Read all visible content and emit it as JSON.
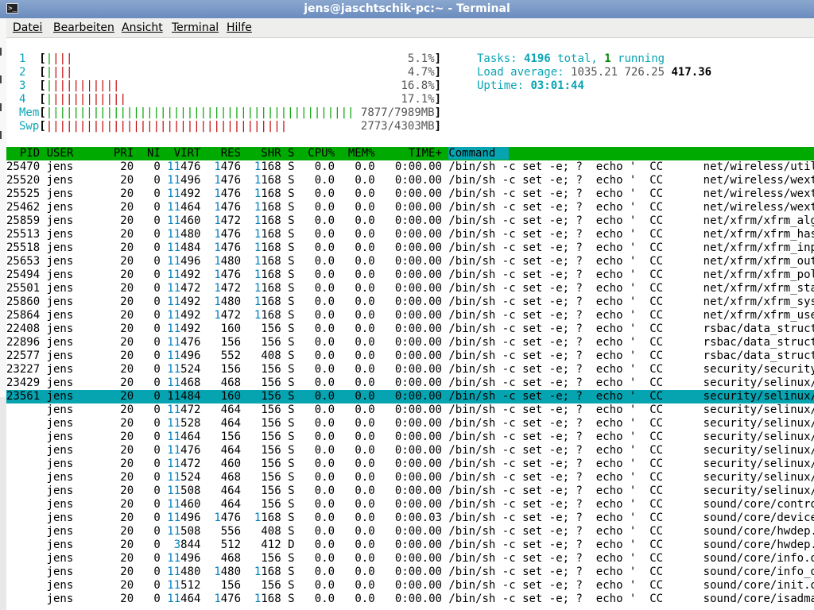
{
  "window": {
    "title": "jens@jaschtschik-pc:~ - Terminal"
  },
  "menu": [
    {
      "label": "Datei"
    },
    {
      "label": "Bearbeiten"
    },
    {
      "label": "Ansicht"
    },
    {
      "label": "Terminal"
    },
    {
      "label": "Hilfe"
    }
  ],
  "meters": {
    "cpus": [
      {
        "id": "1",
        "green": 1,
        "red": 3,
        "pct": "5.1%"
      },
      {
        "id": "2",
        "green": 1,
        "red": 3,
        "pct": "4.7%"
      },
      {
        "id": "3",
        "green": 1,
        "red": 10,
        "pct": "16.8%"
      },
      {
        "id": "4",
        "green": 1,
        "red": 11,
        "pct": "17.1%"
      }
    ],
    "mem": {
      "label": "Mem",
      "value": "7877/7989MB"
    },
    "swp": {
      "label": "Swp",
      "value": "2773/4303MB"
    },
    "tasks_label": "Tasks:",
    "tasks_total": "4196",
    "tasks_total_word": "total,",
    "tasks_running": "1",
    "tasks_running_word": "running",
    "load_label": "Load average:",
    "load1": "1035.21",
    "load5": "726.25",
    "load15": "417.36",
    "uptime_label": "Uptime:",
    "uptime": "03:01:44"
  },
  "columns": [
    "PID",
    "USER",
    "PRI",
    "NI",
    "VIRT",
    "RES",
    "SHR",
    "S",
    "CPU%",
    "MEM%",
    "TIME+",
    "Command"
  ],
  "selected_pid": "23561",
  "processes": [
    {
      "pid": "25470",
      "user": "jens",
      "pri": "20",
      "ni": "0",
      "virt": "11476",
      "res": "1476",
      "shr": "1168",
      "s": "S",
      "cpu": "0.0",
      "mem": "0.0",
      "time": "0:00.00",
      "cmd": "/bin/sh -c set -e; ?  echo '  CC      net/wireless/util.o'; gcc"
    },
    {
      "pid": "25520",
      "user": "jens",
      "pri": "20",
      "ni": "0",
      "virt": "11496",
      "res": "1476",
      "shr": "1168",
      "s": "S",
      "cpu": "0.0",
      "mem": "0.0",
      "time": "0:00.00",
      "cmd": "/bin/sh -c set -e; ?  echo '  CC      net/wireless/wext-compat.o"
    },
    {
      "pid": "25525",
      "user": "jens",
      "pri": "20",
      "ni": "0",
      "virt": "11492",
      "res": "1476",
      "shr": "1168",
      "s": "S",
      "cpu": "0.0",
      "mem": "0.0",
      "time": "0:00.00",
      "cmd": "/bin/sh -c set -e; ?  echo '  CC      net/wireless/wext-sme.o';"
    },
    {
      "pid": "25462",
      "user": "jens",
      "pri": "20",
      "ni": "0",
      "virt": "11464",
      "res": "1476",
      "shr": "1168",
      "s": "S",
      "cpu": "0.0",
      "mem": "0.0",
      "time": "0:00.00",
      "cmd": "/bin/sh -c set -e; ?  echo '  CC      net/wireless/wext.o'; gcc"
    },
    {
      "pid": "25859",
      "user": "jens",
      "pri": "20",
      "ni": "0",
      "virt": "11460",
      "res": "1472",
      "shr": "1168",
      "s": "S",
      "cpu": "0.0",
      "mem": "0.0",
      "time": "0:00.00",
      "cmd": "/bin/sh -c set -e; ?  echo '  CC      net/xfrm/xfrm_algo.o'; gcc"
    },
    {
      "pid": "25513",
      "user": "jens",
      "pri": "20",
      "ni": "0",
      "virt": "11480",
      "res": "1476",
      "shr": "1168",
      "s": "S",
      "cpu": "0.0",
      "mem": "0.0",
      "time": "0:00.00",
      "cmd": "/bin/sh -c set -e; ?  echo '  CC      net/xfrm/xfrm_hash.o'; gcc"
    },
    {
      "pid": "25518",
      "user": "jens",
      "pri": "20",
      "ni": "0",
      "virt": "11484",
      "res": "1476",
      "shr": "1168",
      "s": "S",
      "cpu": "0.0",
      "mem": "0.0",
      "time": "0:00.00",
      "cmd": "/bin/sh -c set -e; ?  echo '  CC      net/xfrm/xfrm_input.o'; gcc"
    },
    {
      "pid": "25653",
      "user": "jens",
      "pri": "20",
      "ni": "0",
      "virt": "11496",
      "res": "1480",
      "shr": "1168",
      "s": "S",
      "cpu": "0.0",
      "mem": "0.0",
      "time": "0:00.00",
      "cmd": "/bin/sh -c set -e; ?  echo '  CC      net/xfrm/xfrm_output.o'; g"
    },
    {
      "pid": "25494",
      "user": "jens",
      "pri": "20",
      "ni": "0",
      "virt": "11492",
      "res": "1476",
      "shr": "1168",
      "s": "S",
      "cpu": "0.0",
      "mem": "0.0",
      "time": "0:00.00",
      "cmd": "/bin/sh -c set -e; ?  echo '  CC      net/xfrm/xfrm_policy.o'; g"
    },
    {
      "pid": "25501",
      "user": "jens",
      "pri": "20",
      "ni": "0",
      "virt": "11472",
      "res": "1472",
      "shr": "1168",
      "s": "S",
      "cpu": "0.0",
      "mem": "0.0",
      "time": "0:00.00",
      "cmd": "/bin/sh -c set -e; ?  echo '  CC      net/xfrm/xfrm_state.o'; gcc"
    },
    {
      "pid": "25860",
      "user": "jens",
      "pri": "20",
      "ni": "0",
      "virt": "11492",
      "res": "1480",
      "shr": "1168",
      "s": "S",
      "cpu": "0.0",
      "mem": "0.0",
      "time": "0:00.00",
      "cmd": "/bin/sh -c set -e; ?  echo '  CC      net/xfrm/xfrm_sysctl.o'; g"
    },
    {
      "pid": "25864",
      "user": "jens",
      "pri": "20",
      "ni": "0",
      "virt": "11492",
      "res": "1472",
      "shr": "1168",
      "s": "S",
      "cpu": "0.0",
      "mem": "0.0",
      "time": "0:00.00",
      "cmd": "/bin/sh -c set -e; ?  echo '  CC      net/xfrm/xfrm_user.o'; gcc"
    },
    {
      "pid": "22408",
      "user": "jens",
      "pri": "20",
      "ni": "0",
      "virt": "11492",
      "res": "160",
      "shr": "156",
      "s": "S",
      "cpu": "0.0",
      "mem": "0.0",
      "time": "0:00.00",
      "cmd": "/bin/sh -c set -e; ?  echo '  CC      rsbac/data_structures/aci_"
    },
    {
      "pid": "22896",
      "user": "jens",
      "pri": "20",
      "ni": "0",
      "virt": "11476",
      "res": "156",
      "shr": "156",
      "s": "S",
      "cpu": "0.0",
      "mem": "0.0",
      "time": "0:00.00",
      "cmd": "/bin/sh -c set -e; ?  echo '  CC      rsbac/data_structures/acl_"
    },
    {
      "pid": "22577",
      "user": "jens",
      "pri": "20",
      "ni": "0",
      "virt": "11496",
      "res": "552",
      "shr": "408",
      "s": "S",
      "cpu": "0.0",
      "mem": "0.0",
      "time": "0:00.00",
      "cmd": "/bin/sh -c set -e; ?  echo '  CC      rsbac/data_structures/gen_"
    },
    {
      "pid": "23227",
      "user": "jens",
      "pri": "20",
      "ni": "0",
      "virt": "11524",
      "res": "156",
      "shr": "156",
      "s": "S",
      "cpu": "0.0",
      "mem": "0.0",
      "time": "0:00.00",
      "cmd": "/bin/sh -c set -e; ?  echo '  CC      security/security.o'; gcc"
    },
    {
      "pid": "23429",
      "user": "jens",
      "pri": "20",
      "ni": "0",
      "virt": "11468",
      "res": "468",
      "shr": "156",
      "s": "S",
      "cpu": "0.0",
      "mem": "0.0",
      "time": "0:00.00",
      "cmd": "/bin/sh -c set -e; ?  echo '  CC      security/selinux/hooks.o';"
    },
    {
      "pid": "23561",
      "user": "jens",
      "pri": "20",
      "ni": "0",
      "virt": "11484",
      "res": "160",
      "shr": "156",
      "s": "S",
      "cpu": "0.0",
      "mem": "0.0",
      "time": "0:00.00",
      "cmd": "/bin/sh -c set -e; ?  echo '  CC      security/selinux/selinuxfs"
    },
    {
      "pid": "",
      "user": "jens",
      "pri": "20",
      "ni": "0",
      "virt": "11472",
      "res": "464",
      "shr": "156",
      "s": "S",
      "cpu": "0.0",
      "mem": "0.0",
      "time": "0:00.00",
      "cmd": "/bin/sh -c set -e; ?  echo '  CC      security/selinux/ss/avtab."
    },
    {
      "pid": "",
      "user": "jens",
      "pri": "20",
      "ni": "0",
      "virt": "11528",
      "res": "464",
      "shr": "156",
      "s": "S",
      "cpu": "0.0",
      "mem": "0.0",
      "time": "0:00.00",
      "cmd": "/bin/sh -c set -e; ?  echo '  CC      security/selinux/ss/condit"
    },
    {
      "pid": "",
      "user": "jens",
      "pri": "20",
      "ni": "0",
      "virt": "11464",
      "res": "156",
      "shr": "156",
      "s": "S",
      "cpu": "0.0",
      "mem": "0.0",
      "time": "0:00.00",
      "cmd": "/bin/sh -c set -e; ?  echo '  CC      security/selinux/ss/ebitma"
    },
    {
      "pid": "",
      "user": "jens",
      "pri": "20",
      "ni": "0",
      "virt": "11476",
      "res": "464",
      "shr": "156",
      "s": "S",
      "cpu": "0.0",
      "mem": "0.0",
      "time": "0:00.00",
      "cmd": "/bin/sh -c set -e; ?  echo '  CC      security/selinux/ss/mls.o'"
    },
    {
      "pid": "",
      "user": "jens",
      "pri": "20",
      "ni": "0",
      "virt": "11472",
      "res": "460",
      "shr": "156",
      "s": "S",
      "cpu": "0.0",
      "mem": "0.0",
      "time": "0:00.00",
      "cmd": "/bin/sh -c set -e; ?  echo '  CC      security/selinux/ss/policy"
    },
    {
      "pid": "",
      "user": "jens",
      "pri": "20",
      "ni": "0",
      "virt": "11524",
      "res": "468",
      "shr": "156",
      "s": "S",
      "cpu": "0.0",
      "mem": "0.0",
      "time": "0:00.00",
      "cmd": "/bin/sh -c set -e; ?  echo '  CC      security/selinux/ss/servic"
    },
    {
      "pid": "",
      "user": "jens",
      "pri": "20",
      "ni": "0",
      "virt": "11508",
      "res": "464",
      "shr": "156",
      "s": "S",
      "cpu": "0.0",
      "mem": "0.0",
      "time": "0:00.00",
      "cmd": "/bin/sh -c set -e; ?  echo '  CC      security/selinux/ss/sidtab"
    },
    {
      "pid": "",
      "user": "jens",
      "pri": "20",
      "ni": "0",
      "virt": "11460",
      "res": "464",
      "shr": "156",
      "s": "S",
      "cpu": "0.0",
      "mem": "0.0",
      "time": "0:00.00",
      "cmd": "/bin/sh -c set -e; ?  echo '  CC      sound/core/control.o'; gcc"
    },
    {
      "pid": "",
      "user": "jens",
      "pri": "20",
      "ni": "0",
      "virt": "11496",
      "res": "1476",
      "shr": "1168",
      "s": "S",
      "cpu": "0.0",
      "mem": "0.0",
      "time": "0:00.03",
      "cmd": "/bin/sh -c set -e; ?  echo '  CC      sound/core/device.o'; gcc"
    },
    {
      "pid": "",
      "user": "jens",
      "pri": "20",
      "ni": "0",
      "virt": "11508",
      "res": "556",
      "shr": "408",
      "s": "S",
      "cpu": "0.0",
      "mem": "0.0",
      "time": "0:00.00",
      "cmd": "/bin/sh -c set -e; ?  echo '  CC      sound/core/hwdep.o'; gcc -"
    },
    {
      "pid": "",
      "user": "jens",
      "pri": "20",
      "ni": "0",
      "virt": "3844",
      "res": "512",
      "shr": "412",
      "s": "D",
      "cpu": "0.0",
      "mem": "0.0",
      "time": "0:00.00",
      "cmd": "/bin/sh -c set -e; ?  echo '  CC      sound/core/hwdep.o'; gcc -"
    },
    {
      "pid": "",
      "user": "jens",
      "pri": "20",
      "ni": "0",
      "virt": "11496",
      "res": "468",
      "shr": "156",
      "s": "S",
      "cpu": "0.0",
      "mem": "0.0",
      "time": "0:00.00",
      "cmd": "/bin/sh -c set -e; ?  echo '  CC      sound/core/info.o'; gcc -W"
    },
    {
      "pid": "",
      "user": "jens",
      "pri": "20",
      "ni": "0",
      "virt": "11480",
      "res": "1480",
      "shr": "1168",
      "s": "S",
      "cpu": "0.0",
      "mem": "0.0",
      "time": "0:00.00",
      "cmd": "/bin/sh -c set -e; ?  echo '  CC      sound/core/info_oss.o'; gcc"
    },
    {
      "pid": "",
      "user": "jens",
      "pri": "20",
      "ni": "0",
      "virt": "11512",
      "res": "156",
      "shr": "156",
      "s": "S",
      "cpu": "0.0",
      "mem": "0.0",
      "time": "0:00.00",
      "cmd": "/bin/sh -c set -e; ?  echo '  CC      sound/core/init.o'; gcc -W"
    },
    {
      "pid": "",
      "user": "jens",
      "pri": "20",
      "ni": "0",
      "virt": "11464",
      "res": "1476",
      "shr": "1168",
      "s": "S",
      "cpu": "0.0",
      "mem": "0.0",
      "time": "0:00.00",
      "cmd": "/bin/sh -c set -e; ?  echo '  CC      sound/core/isadma.o'; gcc"
    }
  ],
  "colors": {
    "header_bg": "#00aa00",
    "selection_bg": "#06a3b0",
    "meter_label": "#0aa5b5",
    "bar_red": "#c00000",
    "bar_green": "#00a000"
  }
}
